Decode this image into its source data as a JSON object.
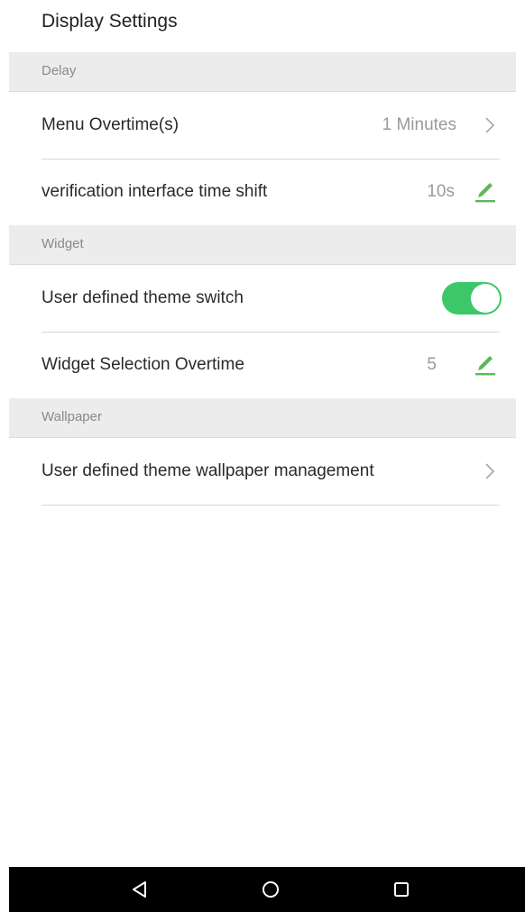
{
  "header": {
    "title": "Display Settings"
  },
  "sections": {
    "delay": {
      "label": "Delay",
      "menu_overtime": {
        "label": "Menu Overtime(s)",
        "value": "1 Minutes",
        "icon": "chevron-right-icon"
      },
      "verification_shift": {
        "label": "verification interface time shift",
        "value": "10s",
        "icon": "pencil-icon"
      }
    },
    "widget": {
      "label": "Widget",
      "theme_switch": {
        "label": "User defined theme switch",
        "enabled": true,
        "icon": "toggle-switch"
      },
      "selection_overtime": {
        "label": "Widget Selection Overtime",
        "value": "5",
        "icon": "pencil-icon"
      }
    },
    "wallpaper": {
      "label": "Wallpaper",
      "management": {
        "label": "User defined theme wallpaper management",
        "icon": "chevron-right-icon"
      }
    }
  },
  "navbar": {
    "back_icon": "back-triangle-icon",
    "home_icon": "home-circle-icon",
    "recents_icon": "recents-square-icon"
  },
  "colors": {
    "accent_green": "#3cc868",
    "edit_icon_green": "#5cb85c",
    "section_bg": "#ececec",
    "navbar_bg": "#000000"
  }
}
